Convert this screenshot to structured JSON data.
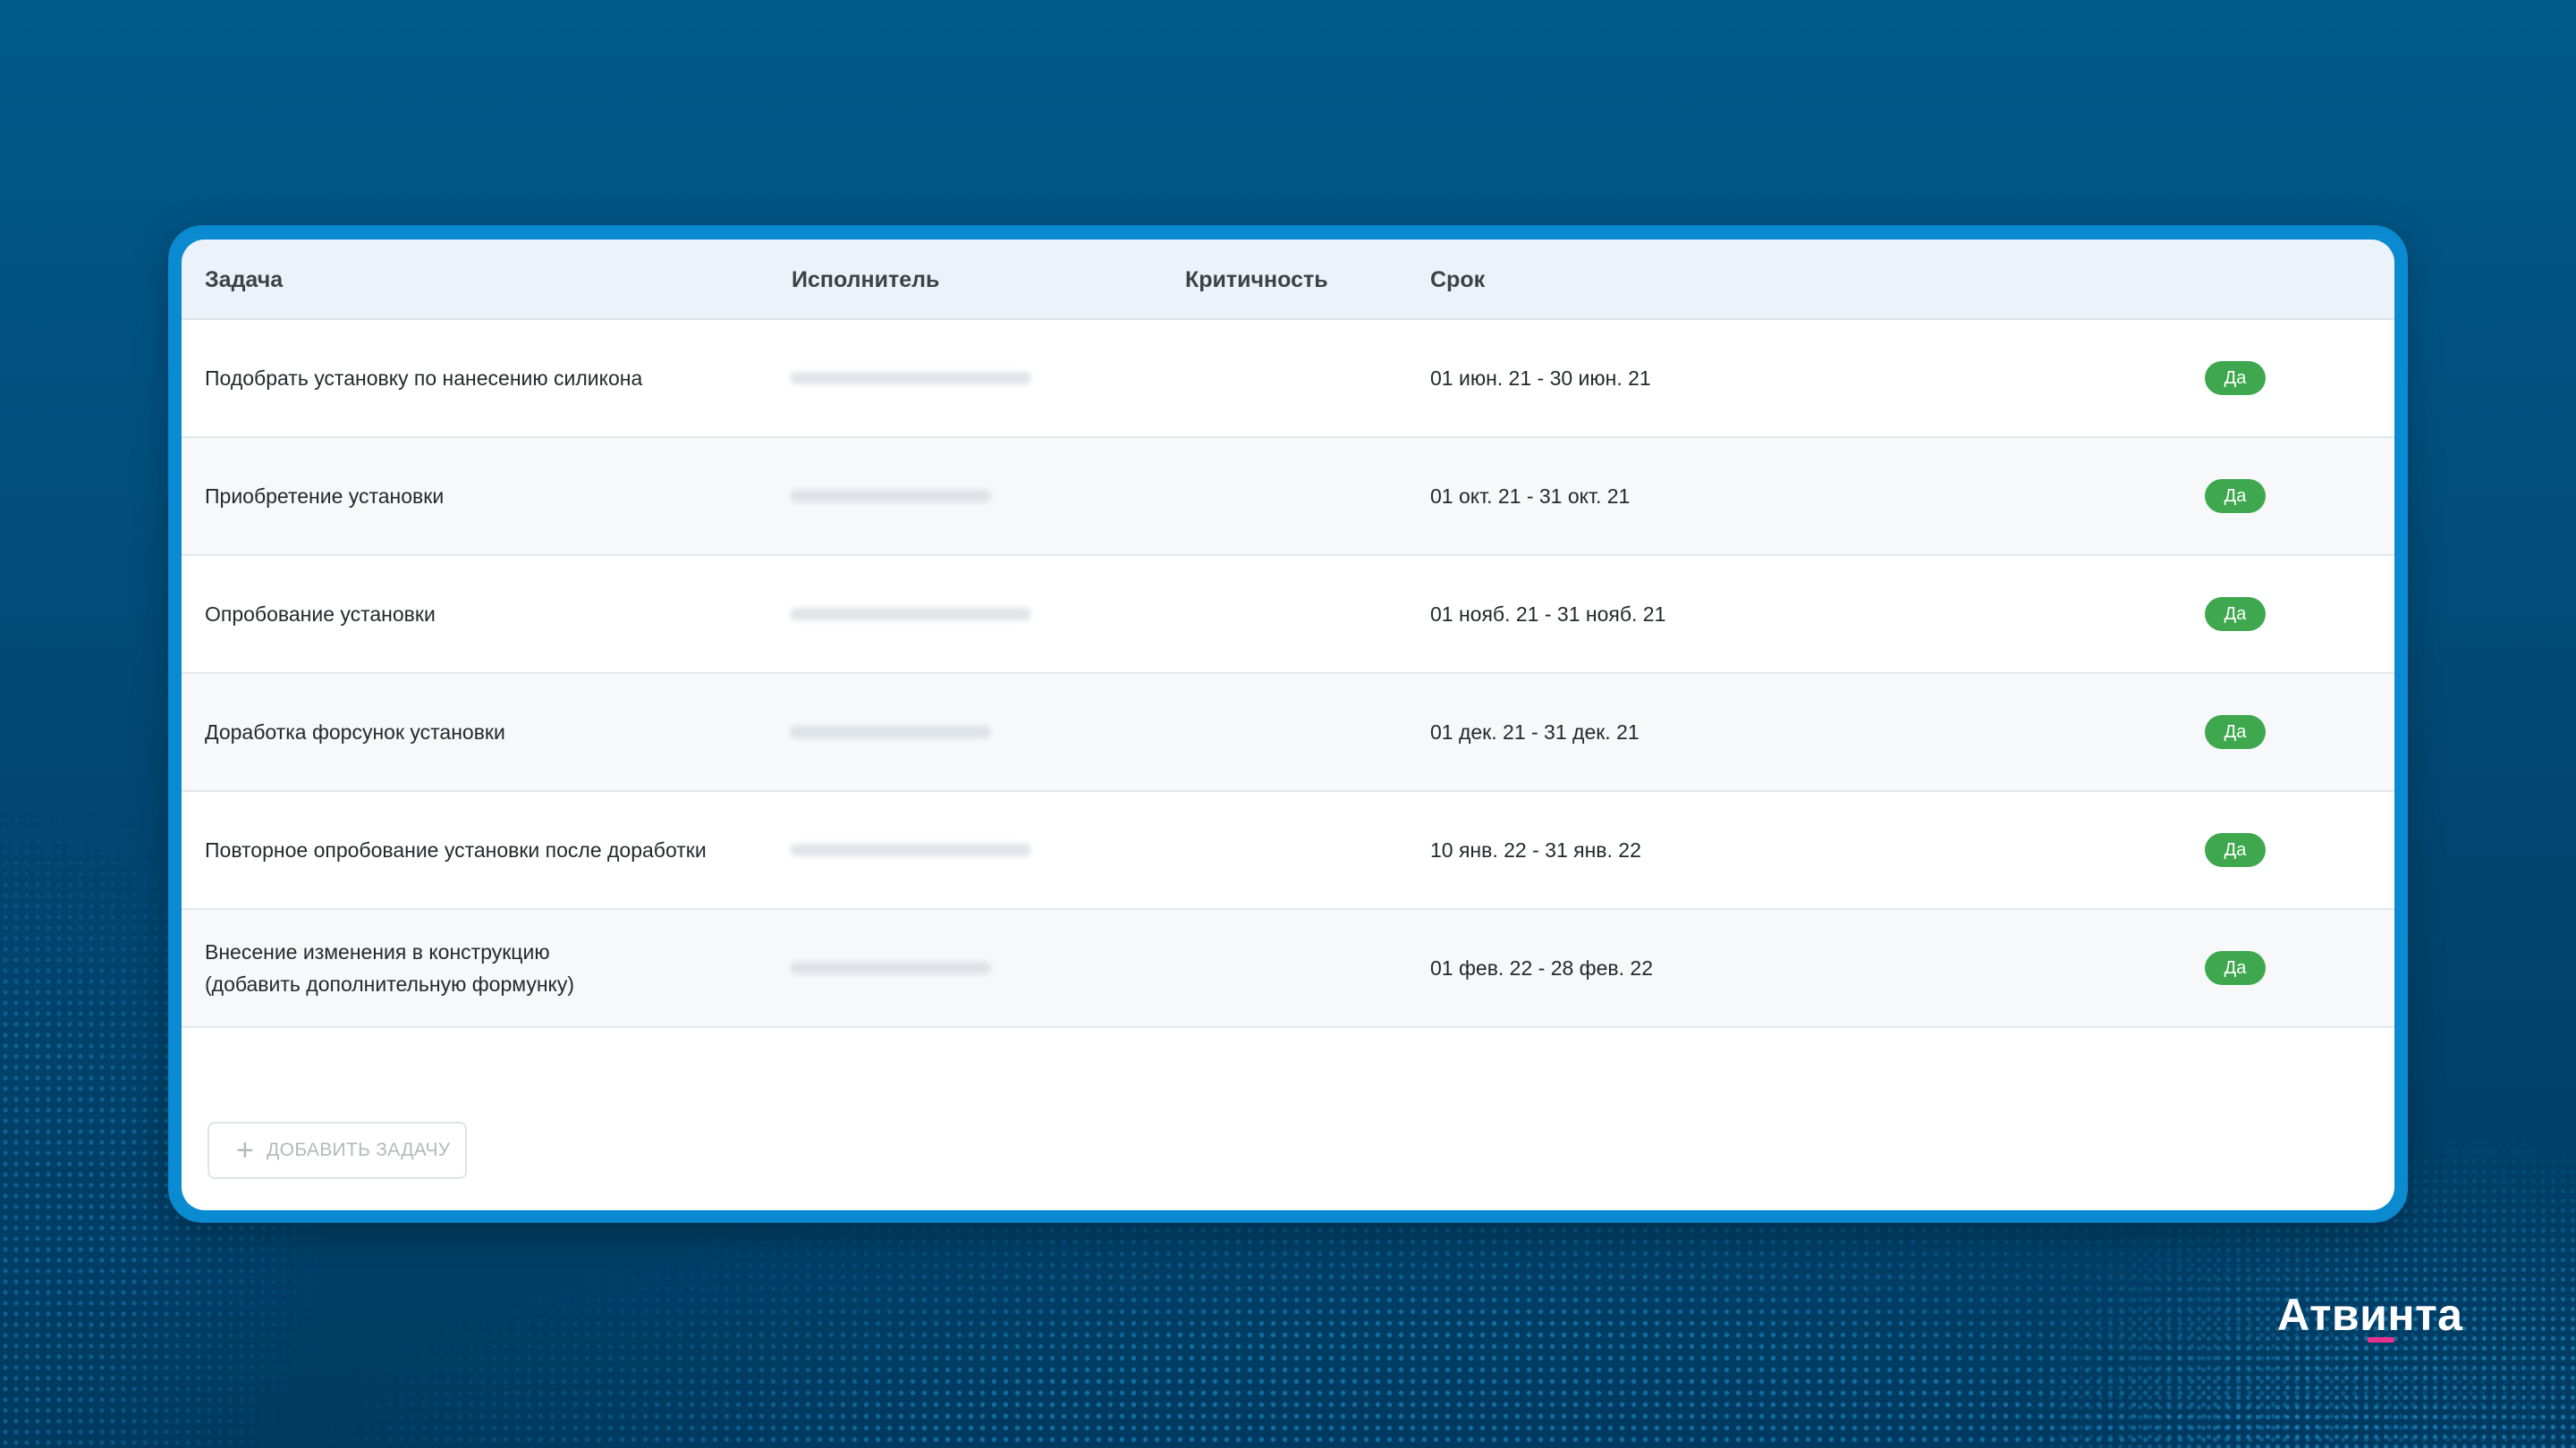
{
  "table": {
    "columns": {
      "task": "Задача",
      "assignee": "Исполнитель",
      "criticality": "Критичность",
      "deadline": "Срок"
    },
    "rows": [
      {
        "task": "Подобрать установку по нанесению силикона",
        "deadline": "01 июн. 21 - 30 июн. 21",
        "flag": "Да"
      },
      {
        "task": "Приобретение установки",
        "deadline": "01 окт. 21 - 31 окт. 21",
        "flag": "Да"
      },
      {
        "task": "Опробование установки",
        "deadline": "01 нояб. 21 - 31 нояб. 21",
        "flag": "Да"
      },
      {
        "task": "Доработка форсунок установки",
        "deadline": "01 дек. 21 - 31 дек. 21",
        "flag": "Да"
      },
      {
        "task": "Повторное опробование установки после доработки",
        "deadline": "10 янв. 22 - 31 янв. 22",
        "flag": "Да"
      },
      {
        "task_line1": "Внесение изменения в конструкцию",
        "task_line2": "(добавить дополнительную формунку)",
        "deadline": "01 фев. 22 - 28 фев. 22",
        "flag": "Да"
      }
    ]
  },
  "add_task_button": {
    "label": "ДОБАВИТЬ ЗАДАЧУ",
    "icon": "plus-icon"
  },
  "brand": {
    "logo": "Атвинта",
    "accent_color": "#e8328d"
  },
  "colors": {
    "background": "#015a8a",
    "frame": "#0a8ad0",
    "badge": "#3fa84f",
    "header_bg": "#ebf2f9"
  }
}
